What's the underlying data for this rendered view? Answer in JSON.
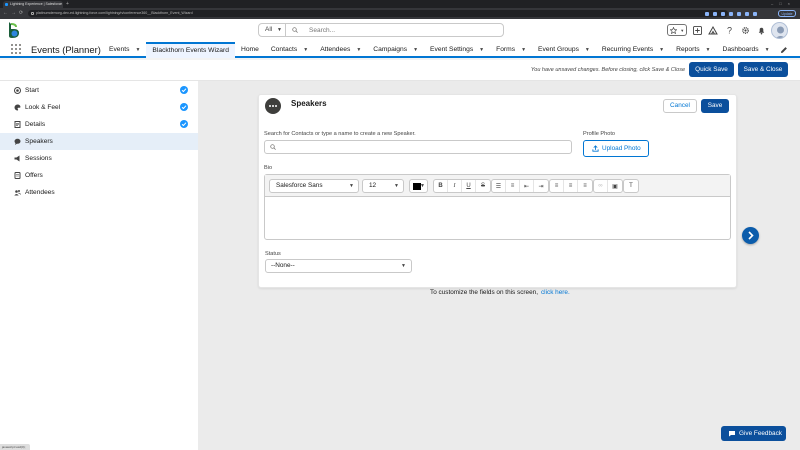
{
  "browser": {
    "tab_title": "Lightning Experience | Salesforce",
    "url": "platinumdemorg-dev-ed.lightning.force.com/lightning/n/conference360__Blackthorn_Event_Wizard",
    "update_label": "Update"
  },
  "header": {
    "search_scope": "All",
    "search_placeholder": "Search...",
    "icons": [
      "favorites-star-icon",
      "global-actions-plus-icon",
      "trailhead-icon",
      "help-icon",
      "setup-gear-icon",
      "notifications-bell-icon"
    ]
  },
  "nav": {
    "app_name": "Events (Planner)",
    "items": [
      {
        "label": "Events",
        "dropdown": true
      },
      {
        "label": "Blackthorn Events Wizard",
        "dropdown": false,
        "active": true
      },
      {
        "label": "Home",
        "dropdown": false
      },
      {
        "label": "Contacts",
        "dropdown": true
      },
      {
        "label": "Attendees",
        "dropdown": true
      },
      {
        "label": "Campaigns",
        "dropdown": true
      },
      {
        "label": "Event Settings",
        "dropdown": true
      },
      {
        "label": "Forms",
        "dropdown": true
      },
      {
        "label": "Event Groups",
        "dropdown": true
      },
      {
        "label": "Recurring Events",
        "dropdown": true
      },
      {
        "label": "Reports",
        "dropdown": true
      },
      {
        "label": "Dashboards",
        "dropdown": true
      }
    ]
  },
  "subheader": {
    "unsaved_message": "You have unsaved changes. Before closing, click Save & Close",
    "quick_save": "Quick Save",
    "save_close": "Save & Close"
  },
  "steps": [
    {
      "label": "Start",
      "icon": "start-icon",
      "done": true
    },
    {
      "label": "Look & Feel",
      "icon": "look-feel-icon",
      "done": true
    },
    {
      "label": "Details",
      "icon": "details-icon",
      "done": true
    },
    {
      "label": "Speakers",
      "icon": "speakers-icon",
      "done": false,
      "current": true
    },
    {
      "label": "Sessions",
      "icon": "sessions-icon",
      "done": false
    },
    {
      "label": "Offers",
      "icon": "offers-icon",
      "done": false
    },
    {
      "label": "Attendees",
      "icon": "attendees-icon",
      "done": false
    }
  ],
  "card": {
    "title": "Speakers",
    "cancel": "Cancel",
    "save": "Save",
    "search_label": "Search for Contacts or type a name to create a new Speaker.",
    "search_value": "",
    "profile_photo_label": "Profile Photo",
    "upload_label": "Upload Photo",
    "bio_label": "Bio",
    "font": "Salesforce Sans",
    "font_size": "12",
    "text_color": "#000000",
    "status_label": "Status",
    "status_value": "--None--"
  },
  "footer": {
    "customize_text": "To customize the fields on this screen,",
    "customize_link": "click here."
  },
  "feedback_label": "Give Feedback",
  "statusbar_text": "javascript:void(0);",
  "colors": {
    "brand": "#0b4f9c",
    "link": "#0176d3",
    "check": "#1b96ff",
    "active_row": "#e5eef8"
  }
}
